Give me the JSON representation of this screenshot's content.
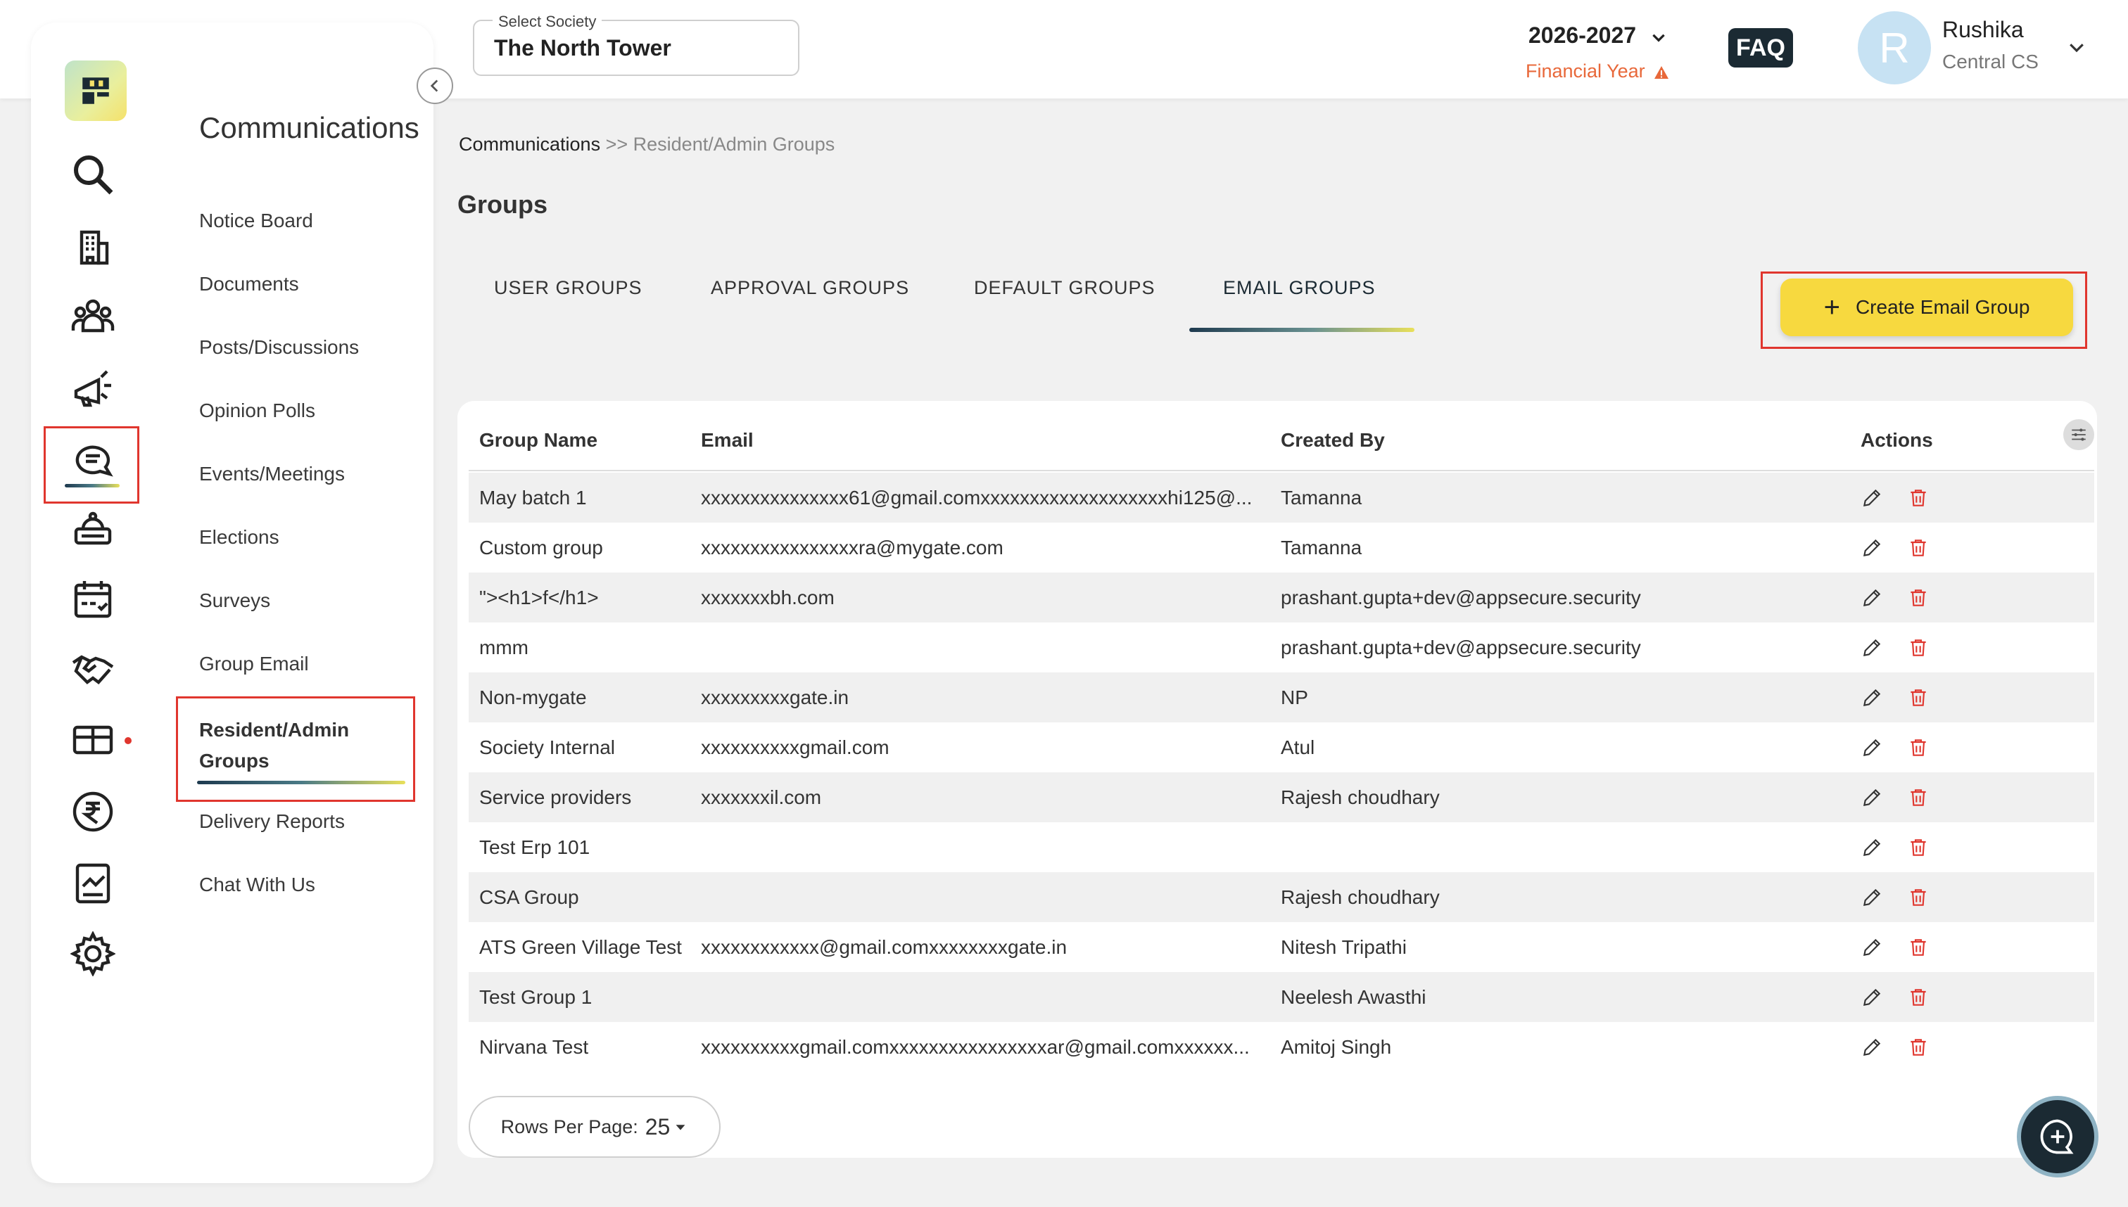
{
  "header": {
    "society_label": "Select Society",
    "society_value": "The North Tower",
    "financial_year": "2026-2027",
    "financial_year_label": "Financial Year",
    "faq_label": "FAQ",
    "user_initial": "R",
    "user_name": "Rushika",
    "user_role": "Central CS"
  },
  "submenu": {
    "title": "Communications",
    "items": [
      {
        "label": "Notice Board"
      },
      {
        "label": "Documents"
      },
      {
        "label": "Posts/Discussions"
      },
      {
        "label": "Opinion Polls"
      },
      {
        "label": "Events/Meetings"
      },
      {
        "label": "Elections"
      },
      {
        "label": "Surveys"
      },
      {
        "label": "Group Email"
      },
      {
        "label": "Resident/Admin Groups"
      },
      {
        "label": "Delivery Reports"
      },
      {
        "label": "Chat With Us"
      }
    ],
    "active_index": 8
  },
  "breadcrumb": {
    "root": "Communications",
    "separator": ">>",
    "current": "Resident/Admin Groups"
  },
  "page": {
    "title": "Groups",
    "tabs": [
      {
        "label": "USER GROUPS"
      },
      {
        "label": "APPROVAL GROUPS"
      },
      {
        "label": "DEFAULT GROUPS"
      },
      {
        "label": "EMAIL GROUPS"
      }
    ],
    "active_tab": 3,
    "create_button": "Create Email Group"
  },
  "table": {
    "columns": [
      "Group Name",
      "Email",
      "Created By",
      "Actions"
    ],
    "rows": [
      {
        "name": "May batch 1",
        "email": "xxxxxxxxxxxxxxx61@gmail.comxxxxxxxxxxxxxxxxxxxhi125@...",
        "created_by": "Tamanna"
      },
      {
        "name": "Custom group",
        "email": "xxxxxxxxxxxxxxxxra@mygate.com",
        "created_by": "Tamanna"
      },
      {
        "name": "\"><h1>f</h1>",
        "email": "xxxxxxxbh.com",
        "created_by": "prashant.gupta+dev@appsecure.security"
      },
      {
        "name": "mmm",
        "email": "",
        "created_by": "prashant.gupta+dev@appsecure.security"
      },
      {
        "name": "Non-mygate",
        "email": "xxxxxxxxxgate.in",
        "created_by": "NP"
      },
      {
        "name": "Society Internal",
        "email": "xxxxxxxxxxgmail.com",
        "created_by": "Atul"
      },
      {
        "name": "Service providers",
        "email": "xxxxxxxil.com",
        "created_by": "Rajesh choudhary"
      },
      {
        "name": "Test Erp 101",
        "email": "",
        "created_by": ""
      },
      {
        "name": "CSA Group",
        "email": "",
        "created_by": "Rajesh choudhary"
      },
      {
        "name": "ATS Green Village Test",
        "email": "xxxxxxxxxxxx@gmail.comxxxxxxxxgate.in",
        "created_by": "Nitesh Tripathi"
      },
      {
        "name": "Test Group 1",
        "email": "",
        "created_by": "Neelesh Awasthi"
      },
      {
        "name": "Nirvana Test",
        "email": "xxxxxxxxxxgmail.comxxxxxxxxxxxxxxxxar@gmail.comxxxxxx...",
        "created_by": "Amitoj Singh"
      }
    ]
  },
  "pagination": {
    "rows_per_page_label": "Rows Per Page:",
    "rows_per_page_value": "25"
  },
  "colors": {
    "accent_yellow": "#f7d93f",
    "highlight_red": "#e0362e",
    "warning_orange": "#e8683a",
    "dark": "#1b2a33"
  },
  "icons": {
    "rail": [
      "search-icon",
      "building-icon",
      "people-icon",
      "megaphone-icon",
      "chat-icon",
      "helpdesk-icon",
      "calendar-icon",
      "handshake-icon",
      "gift-icon",
      "rupee-icon",
      "report-icon",
      "gear-icon"
    ],
    "row_actions": [
      "edit-pencil-icon",
      "delete-trash-icon"
    ]
  }
}
